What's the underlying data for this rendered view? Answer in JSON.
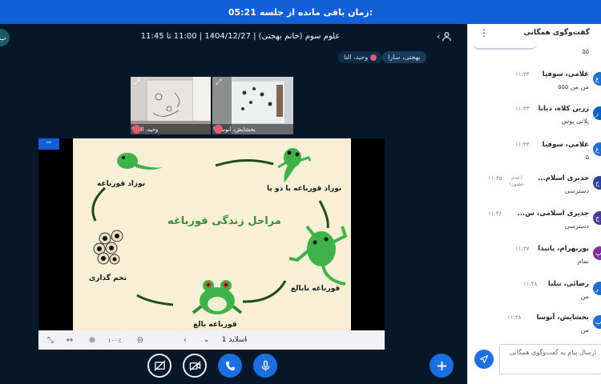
{
  "timer": {
    "label": "زمان باقی مانده از جلسه:",
    "value": "05:21"
  },
  "left_stub": {
    "text": "ب"
  },
  "meeting": {
    "title": "علوم سوم (خانم بهجتی) | 1404/12/27 | 11:00 تا 11:45",
    "talkers": [
      "بهجتی، سارا",
      "وحید، النا"
    ]
  },
  "webcams": [
    {
      "name": "وحید، النا"
    },
    {
      "name": "بخشایش، آنوسا"
    }
  ],
  "slide": {
    "title": "مراحل زندگی قورباغه",
    "labels": {
      "tadpole": "نوزاد قورباغه",
      "tadpole_legs": "نوزاد قورباغه با دو پا",
      "eggs": "تخم گذاری",
      "juvenile": "قورباغه نابالغ",
      "adult": "قورباغه بالغ"
    }
  },
  "pres_toolbar": {
    "zoom": "۱۰۰٪",
    "slide_select": "اسلاید 1",
    "minimize": "−"
  },
  "chat": {
    "title": "گفت‌وگوی همگانی",
    "top_text": "۵۵",
    "messages": [
      {
        "initial": "غ",
        "color": "#1f6fd0",
        "name": "غلامی، سوفیا",
        "time": "۱۱:۳۳",
        "text": "من من ۵۵۵"
      },
      {
        "initial": "ز",
        "color": "#0f5ec4",
        "name": "زرین کلاه، دیانا",
        "time": "۱۱:۳۳",
        "text": "پلاتی پوس"
      },
      {
        "initial": "غ",
        "color": "#1f6fd0",
        "name": "غلامی، سوفیا",
        "time": "۱۱:۳۴",
        "text": "۵"
      },
      {
        "initial": "ج",
        "color": "#2d3f9a",
        "name": "جدیری اسلام...",
        "time": "۱۱:۳۵",
        "note": "(عدم حضور)",
        "text": "دسترسی"
      },
      {
        "initial": "ج",
        "color": "#4a3a9c",
        "name": "جدیری اسلامی، س...",
        "time": "۱۱:۳۶",
        "text": "دسترسی"
      },
      {
        "initial": "پ",
        "color": "#7a2f9a",
        "name": "پوربهرام، پانیذا",
        "time": "۱۱:۳۷",
        "text": "نمام"
      },
      {
        "initial": "ر",
        "color": "#1f6fd0",
        "name": "رضائی، نیلیا",
        "time": "۱۱:۳۸",
        "text": "من"
      },
      {
        "initial": "ب",
        "color": "#1f6fd0",
        "name": "بخشایش، آنوسا",
        "time": "۱۱:۳۸",
        "text": "من"
      }
    ],
    "input_placeholder": "ارسال پیام به گفت‌وگوی همگانی"
  },
  "colors": {
    "accent": "#1160d8",
    "bg": "#06172a",
    "chat_bg": "#ffffff",
    "mute": "#e05c77"
  }
}
